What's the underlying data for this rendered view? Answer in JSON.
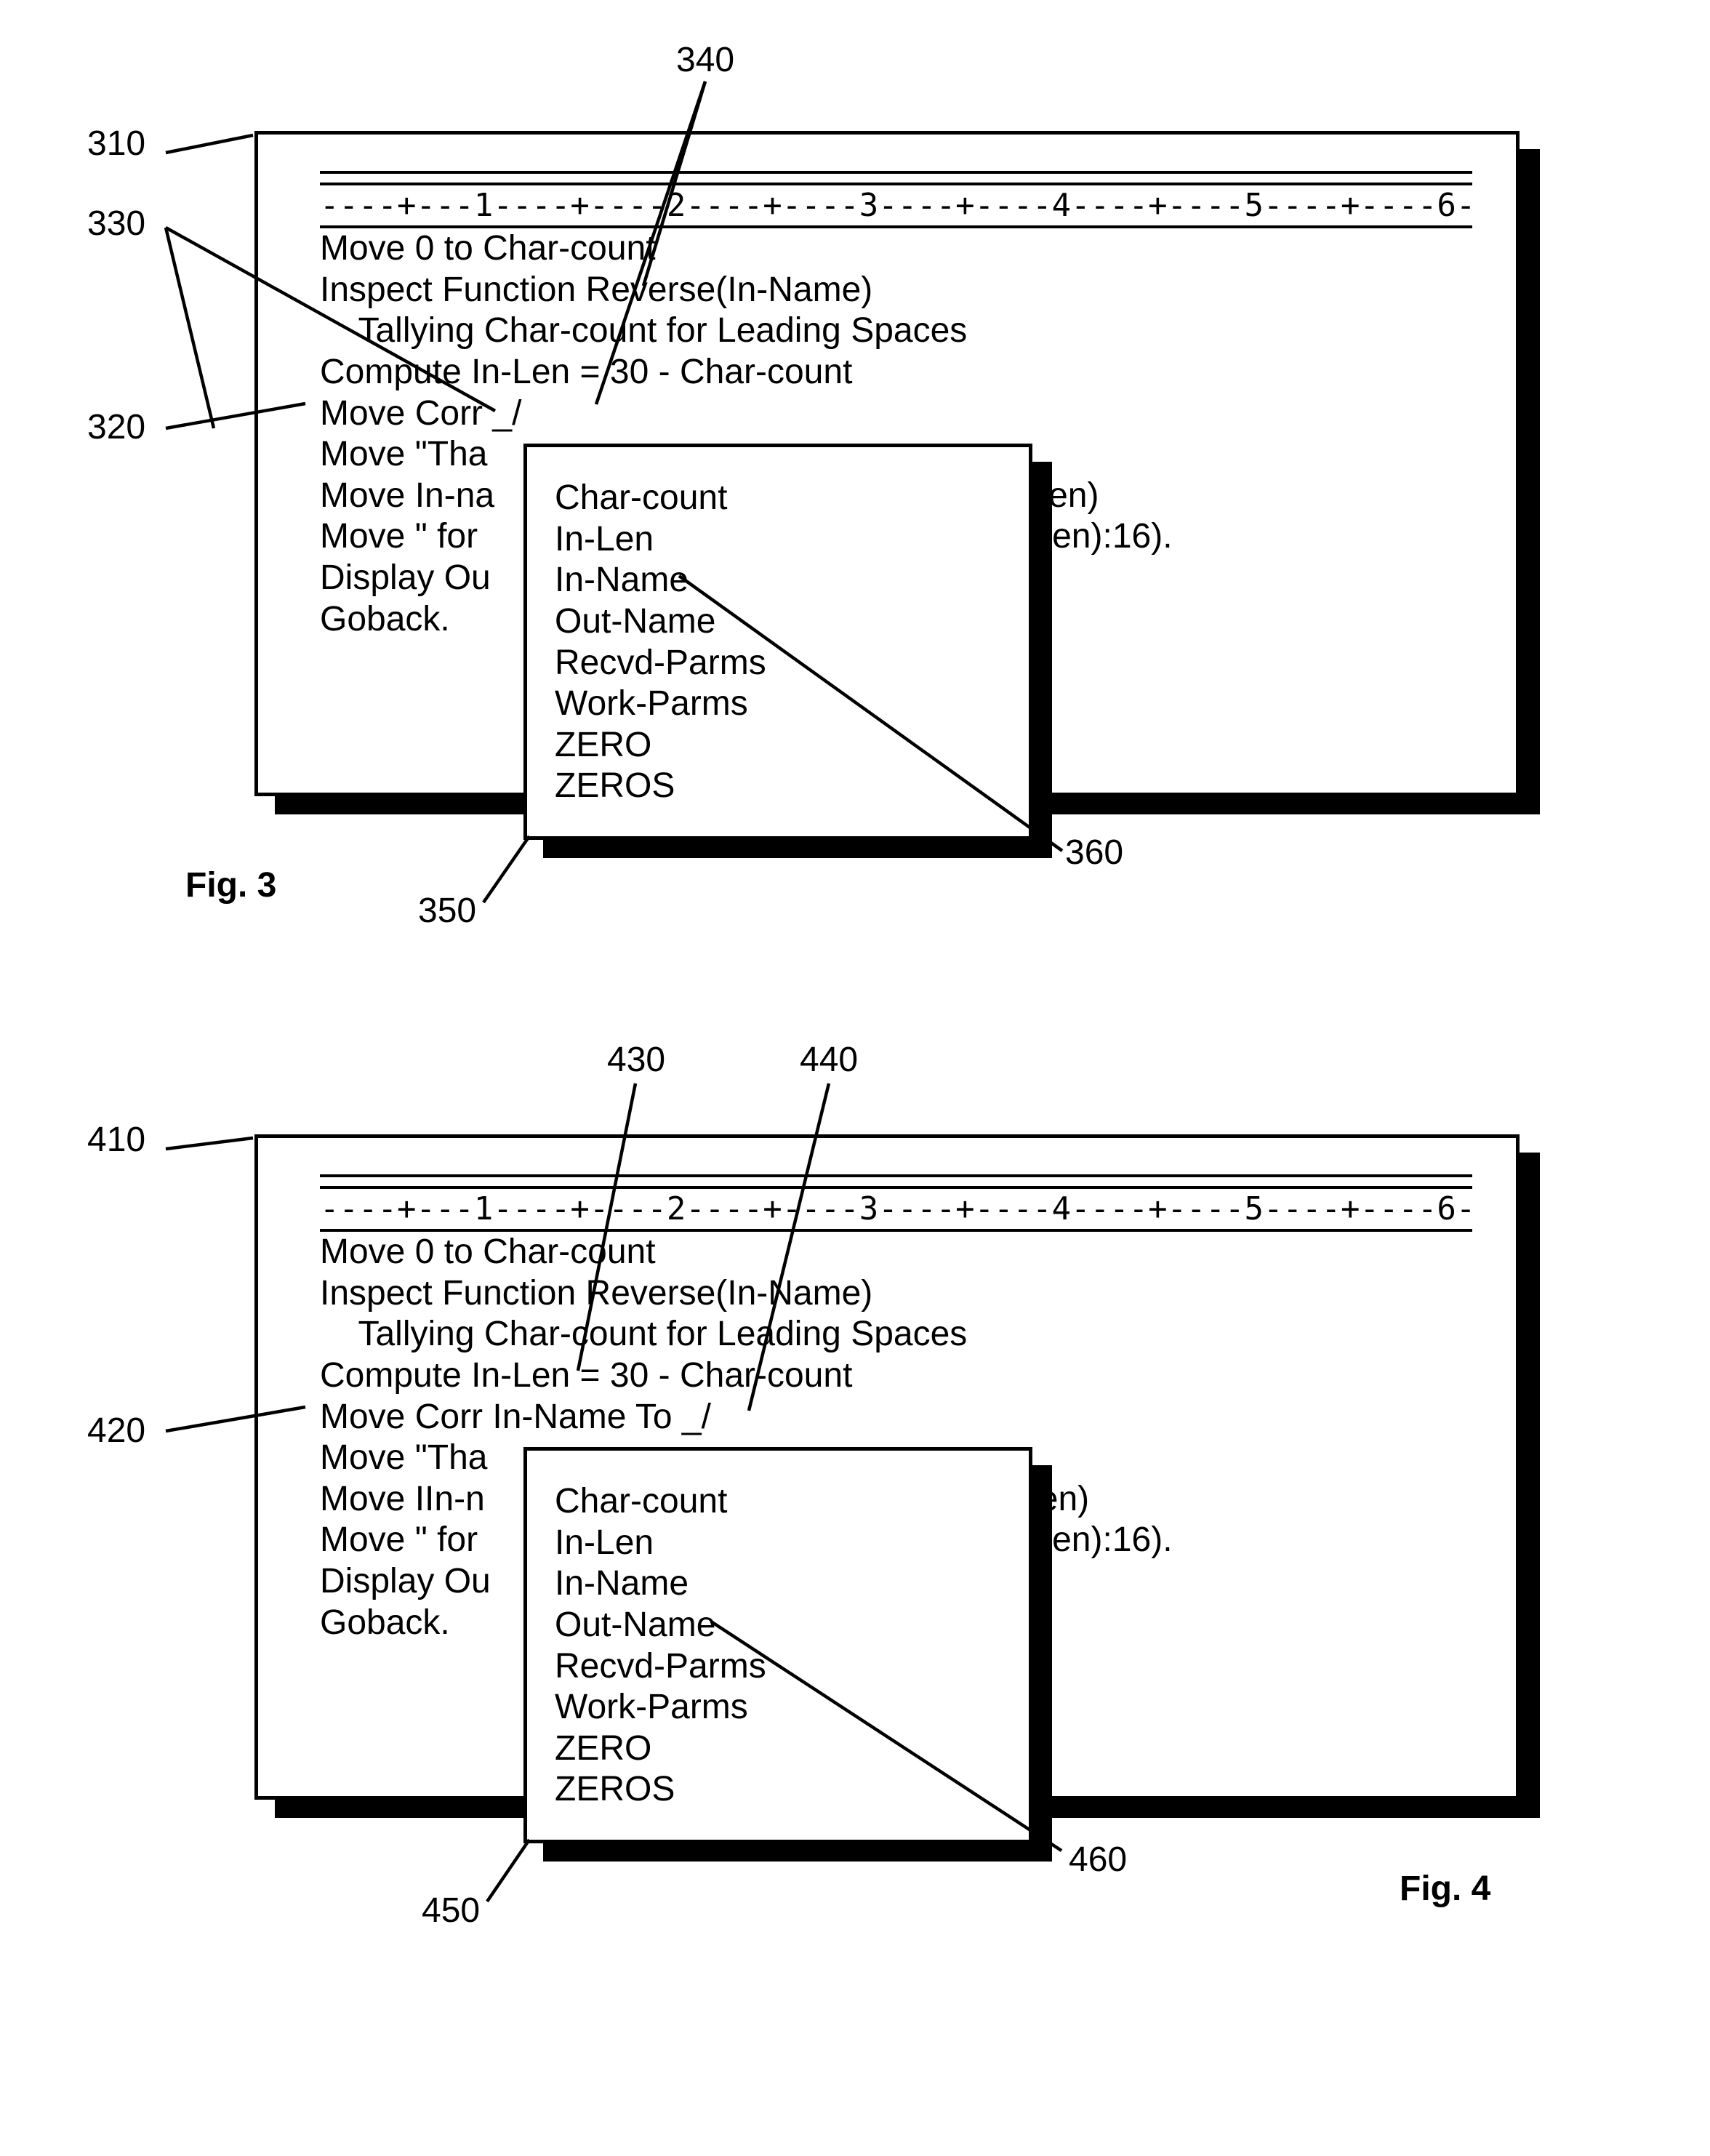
{
  "fig3": {
    "labels": {
      "l310": "310",
      "l330": "330",
      "l320": "320",
      "l340": "340",
      "l350": "350",
      "l360": "360",
      "caption": "Fig. 3"
    },
    "ruler": "----+---1----+----2----+----3----+----4----+----5----+----6----+-",
    "code": "Move 0 to Char-count\nInspect Function Reverse(In-Name)\n    Tallying Char-count for Leading Spaces\nCompute In-Len = 30 - Char-count\nMove Corr _/\nMove \"Tha\nMove In-na                                             (11:In-Len)\nMove \" for                                            (11 + In-Len):16).\nDisplay Ou\nGoback.",
    "popup": {
      "items": [
        "Char-count",
        "In-Len",
        "In-Name",
        "Out-Name",
        "Recvd-Parms",
        "Work-Parms",
        "ZERO",
        "ZEROS"
      ]
    }
  },
  "fig4": {
    "labels": {
      "l410": "410",
      "l420": "420",
      "l430": "430",
      "l440": "440",
      "l450": "450",
      "l460": "460",
      "caption": "Fig. 4"
    },
    "ruler": "----+---1----+----2----+----3----+----4----+----5----+----6----+-",
    "code": "Move 0 to Char-count\nInspect Function Reverse(In-Name)\n    Tallying Char-count for Leading Spaces\nCompute In-Len = 30 - Char-count\nMove Corr In-Name To _/\nMove \"Tha\nMove IIn-n                                          e (11:In-Len)\nMove \" for                                            (11 + In-Len):16).\nDisplay Ou\nGoback.",
    "popup": {
      "items": [
        "Char-count",
        "In-Len",
        "In-Name",
        "Out-Name",
        "Recvd-Parms",
        "Work-Parms",
        "ZERO",
        "ZEROS"
      ]
    }
  }
}
